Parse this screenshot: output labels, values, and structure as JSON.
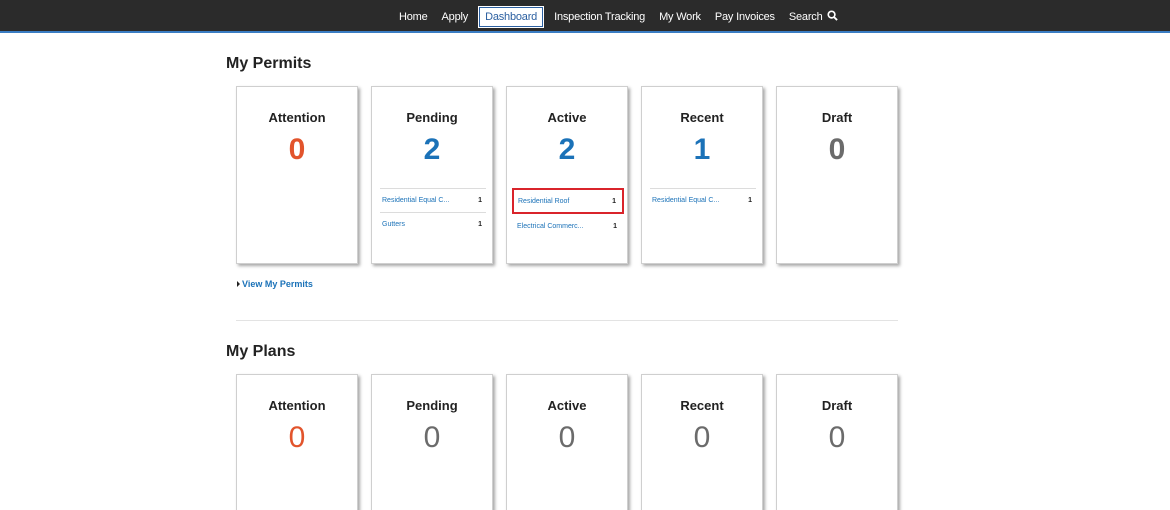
{
  "nav": {
    "items": [
      {
        "label": "Home",
        "active": false
      },
      {
        "label": "Apply",
        "active": false
      },
      {
        "label": "Dashboard",
        "active": true
      },
      {
        "label": "Inspection Tracking",
        "active": false
      },
      {
        "label": "My Work",
        "active": false
      },
      {
        "label": "Pay Invoices",
        "active": false
      },
      {
        "label": "Search",
        "active": false,
        "icon": "search-icon"
      }
    ]
  },
  "permits": {
    "title": "My Permits",
    "cards": [
      {
        "title": "Attention",
        "count": "0",
        "rows": []
      },
      {
        "title": "Pending",
        "count": "2",
        "rows": [
          {
            "label": "Residential Equal C...",
            "count": "1"
          },
          {
            "label": "Gutters",
            "count": "1"
          }
        ]
      },
      {
        "title": "Active",
        "count": "2",
        "rows": [
          {
            "label": "Residential Roof",
            "count": "1"
          },
          {
            "label": "Electrical Commerc...",
            "count": "1"
          }
        ]
      },
      {
        "title": "Recent",
        "count": "1",
        "rows": [
          {
            "label": "Residential Equal C...",
            "count": "1"
          }
        ]
      },
      {
        "title": "Draft",
        "count": "0",
        "rows": []
      }
    ],
    "view_link": "View My Permits"
  },
  "plans": {
    "title": "My Plans",
    "cards": [
      {
        "title": "Attention",
        "count": "0"
      },
      {
        "title": "Pending",
        "count": "0"
      },
      {
        "title": "Active",
        "count": "0"
      },
      {
        "title": "Recent",
        "count": "0"
      },
      {
        "title": "Draft",
        "count": "0"
      }
    ]
  },
  "colors": {
    "nav_bg": "#2b2b2b",
    "accent_blue": "#1b72b8",
    "attention_red": "#e2542c",
    "zero_gray": "#6b6b6b",
    "highlight_red": "#d9242b"
  }
}
